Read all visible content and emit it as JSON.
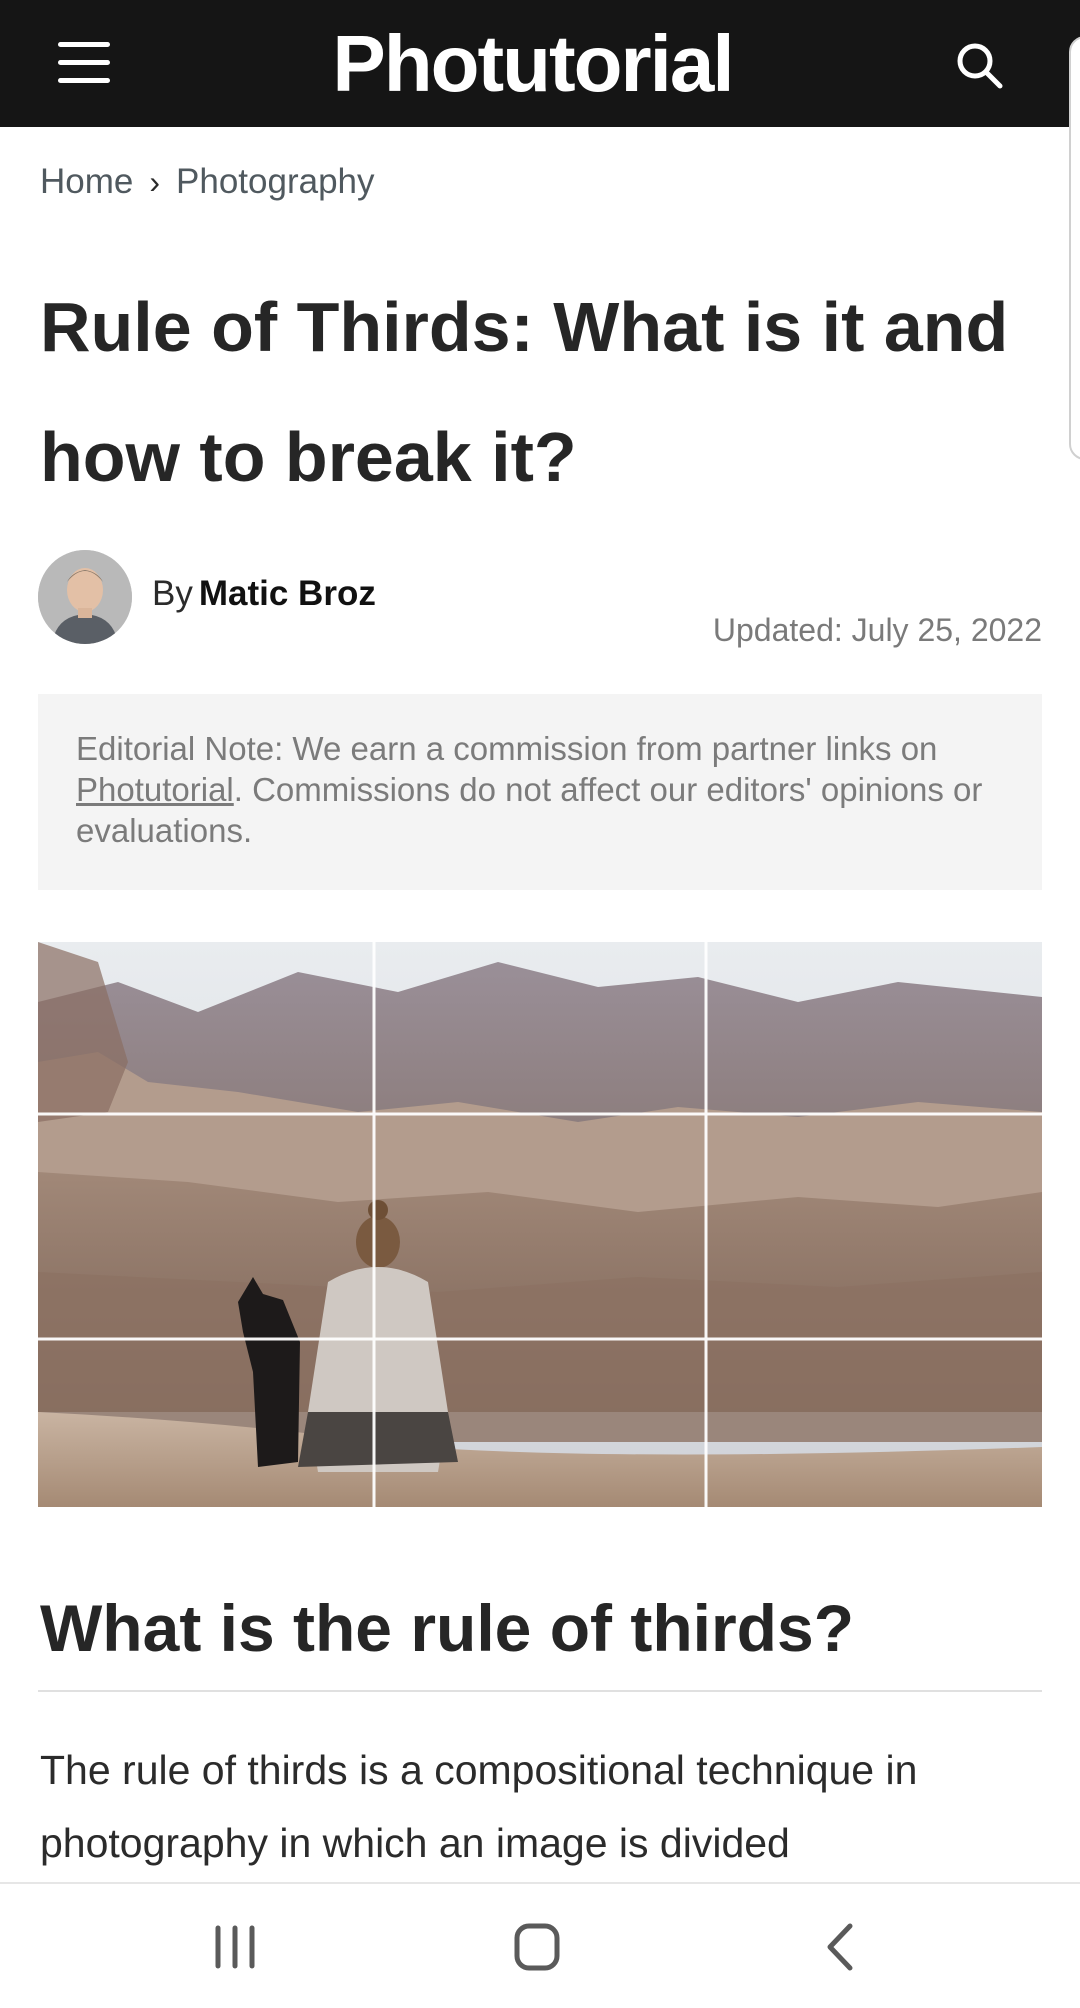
{
  "header": {
    "logo": "Photutorial",
    "menu_icon": "hamburger-menu-icon",
    "search_icon": "search-icon",
    "background": "#151515"
  },
  "breadcrumb": {
    "items": [
      "Home",
      "Photography"
    ],
    "separator_icon": "chevron-right-icon"
  },
  "article": {
    "title": "Rule of Thirds: What is it and how to break it?",
    "byline_prefix": "By",
    "author": "Matic Broz",
    "updated": "Updated: July 25, 2022",
    "editorial_note": {
      "prefix": "Editorial Note: We earn a commission from partner links on ",
      "link": "Photutorial",
      "suffix": ". Commissions do not affect our editors' opinions or evaluations."
    },
    "hero_image": "canyon-landscape-with-rule-of-thirds-grid",
    "section_heading": "What is the rule of thirds?",
    "paragraph": "The rule of thirds is a compositional technique in photography in which an image is divided"
  },
  "system_nav": {
    "recents_icon": "recent-apps-icon",
    "home_icon": "home-icon",
    "back_icon": "back-icon"
  }
}
